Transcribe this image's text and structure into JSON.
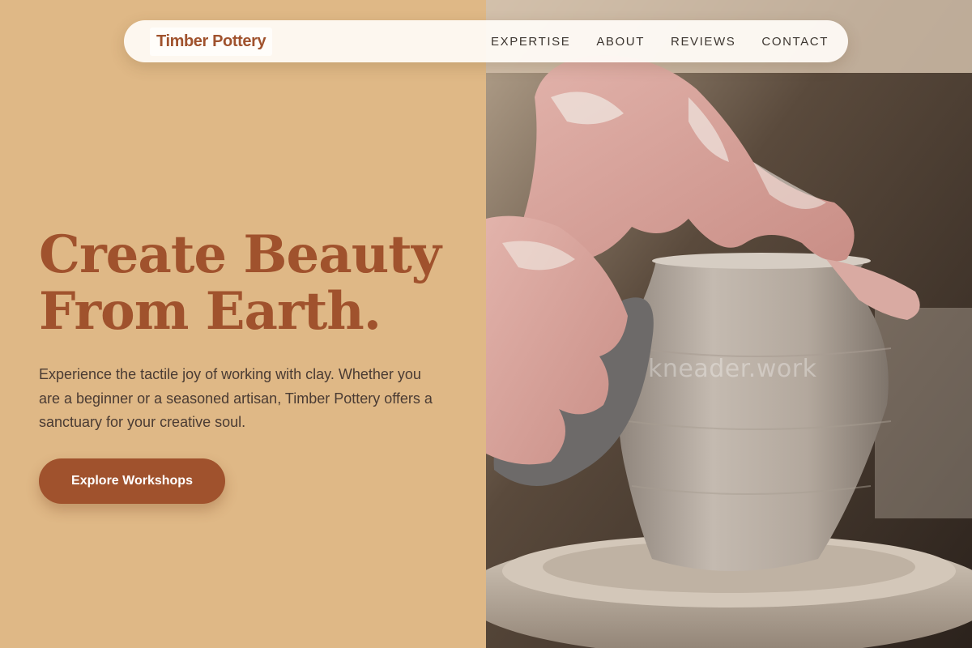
{
  "brand": {
    "name": "Timber Pottery"
  },
  "nav": {
    "items": [
      {
        "label": "EXPERTISE"
      },
      {
        "label": "ABOUT"
      },
      {
        "label": "REVIEWS"
      },
      {
        "label": "CONTACT"
      }
    ]
  },
  "hero": {
    "headline_line1": "Create Beauty",
    "headline_line2": "From Earth.",
    "description": "Experience the tactile joy of working with clay. Whether you are a beginner or a seasoned artisan, Timber Pottery offers a sanctuary for your creative soul.",
    "cta_label": "Explore Workshops"
  },
  "image": {
    "watermark": "kneader.work"
  },
  "colors": {
    "background": "#dfb886",
    "accent": "#a0522d",
    "nav_bg": "#fffcf8",
    "text": "#4a3b33"
  }
}
